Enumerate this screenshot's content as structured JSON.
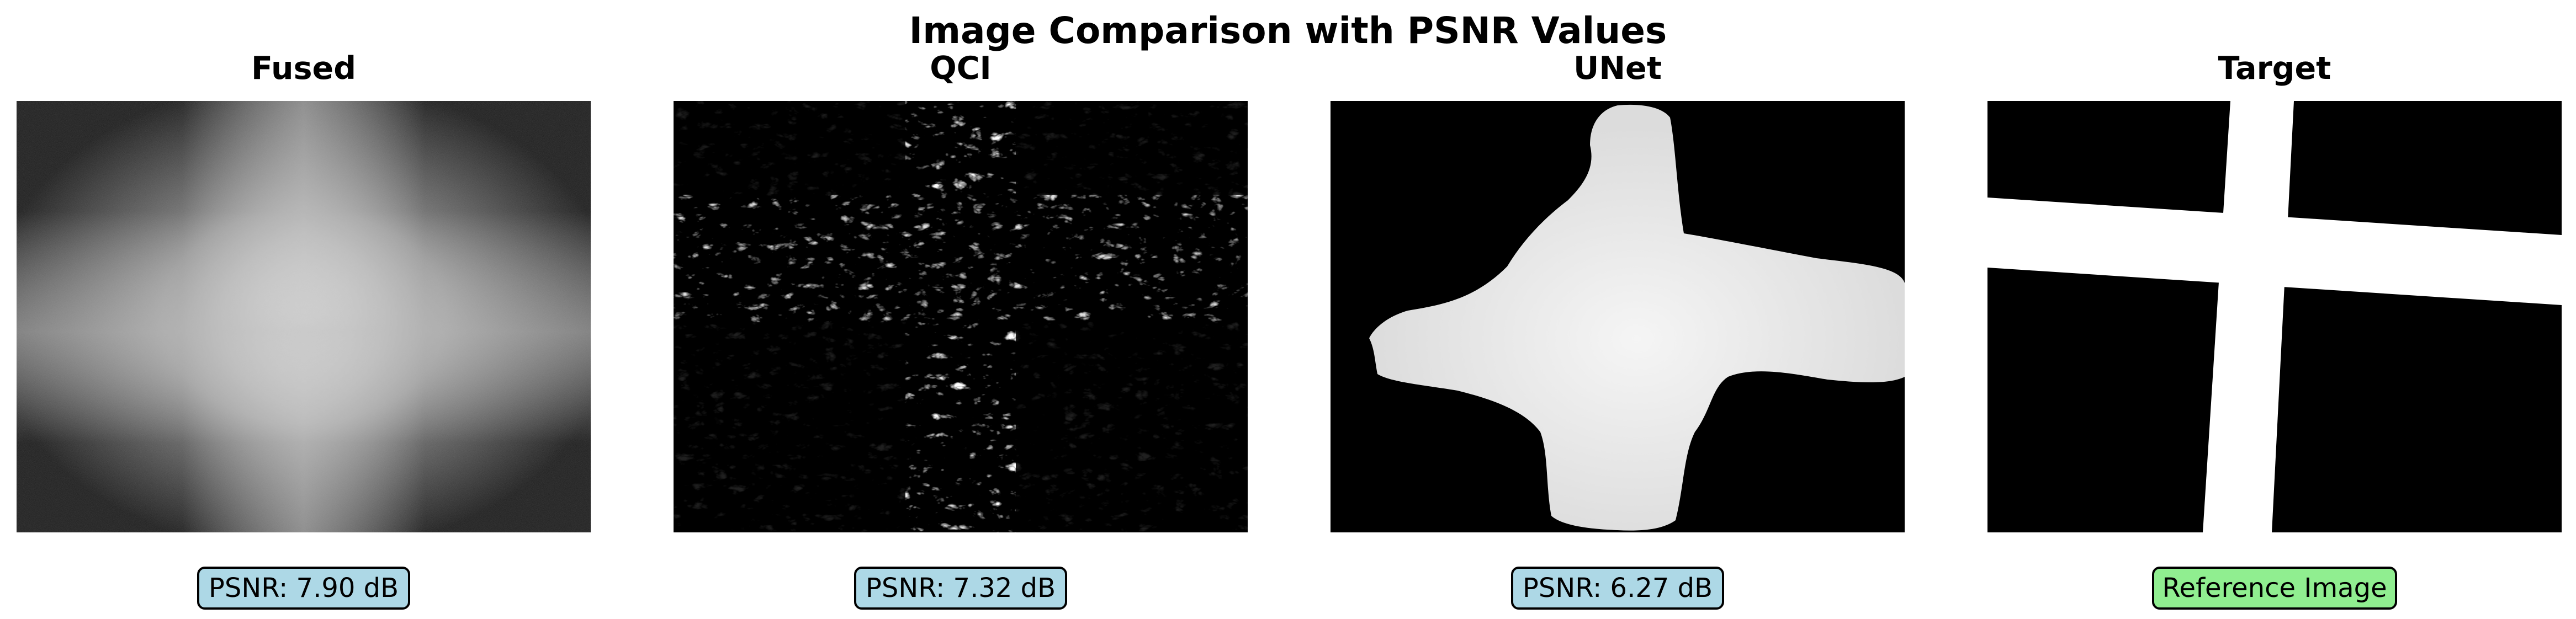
{
  "chart_data": {
    "type": "image_grid",
    "title": "Image Comparison with PSNR Values",
    "panels": [
      {
        "title": "Fused",
        "label": "PSNR: 7.90 dB",
        "psnr_db": 7.9,
        "label_color": "#add8e6"
      },
      {
        "title": "QCI",
        "label": "PSNR: 7.32 dB",
        "psnr_db": 7.32,
        "label_color": "#add8e6"
      },
      {
        "title": "UNet",
        "label": "PSNR: 6.27 dB",
        "psnr_db": 6.27,
        "label_color": "#add8e6"
      },
      {
        "title": "Target",
        "label": "Reference Image",
        "label_color": "#90ee90"
      }
    ]
  }
}
